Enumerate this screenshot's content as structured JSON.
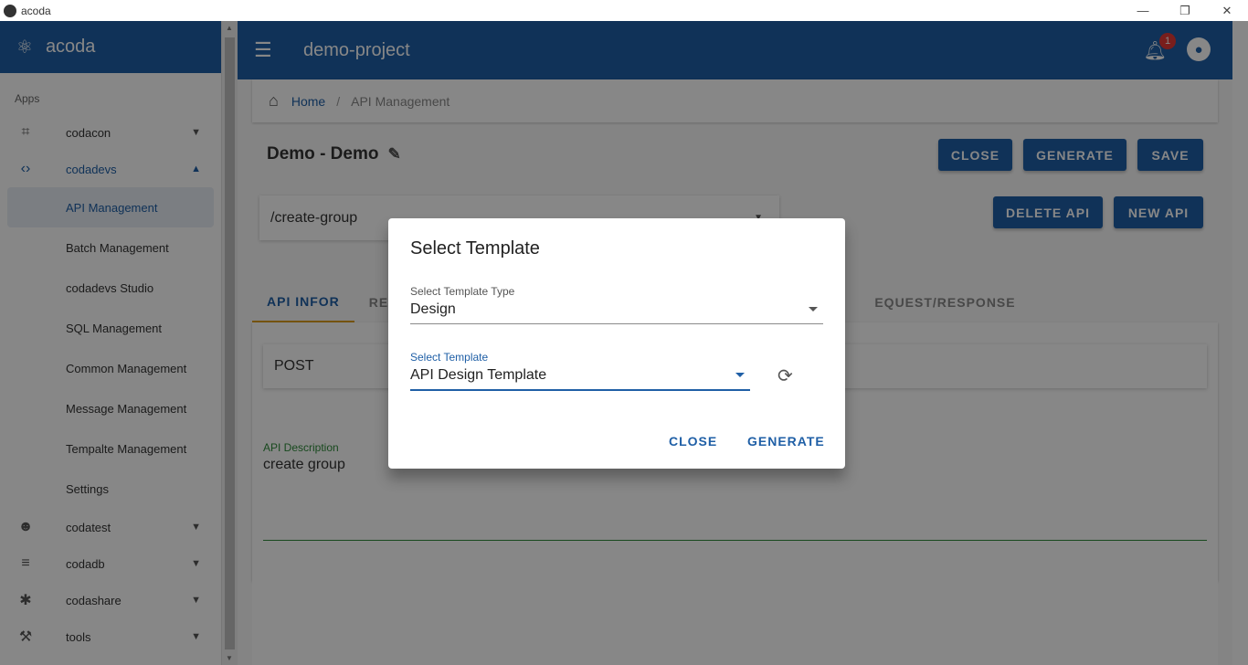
{
  "window": {
    "title": "acoda",
    "controls": [
      "—",
      "❐",
      "✕"
    ]
  },
  "sidebar": {
    "brand": "acoda",
    "section_label": "Apps",
    "groups": [
      {
        "label": "codacon",
        "icon": "crop-icon",
        "expanded": false
      },
      {
        "label": "codadevs",
        "icon": "code-icon",
        "expanded": true,
        "items": [
          "API Management",
          "Batch Management",
          "codadevs Studio",
          "SQL Management",
          "Common Management",
          "Message Management",
          "Tempalte Management",
          "Settings"
        ]
      },
      {
        "label": "codatest",
        "icon": "users-gear-icon",
        "expanded": false
      },
      {
        "label": "codadb",
        "icon": "database-icon",
        "expanded": false
      },
      {
        "label": "codashare",
        "icon": "share-network-icon",
        "expanded": false
      },
      {
        "label": "tools",
        "icon": "tools-icon",
        "expanded": false
      }
    ],
    "selected_item": "API Management"
  },
  "appbar": {
    "project": "demo-project",
    "notification_count": "1"
  },
  "breadcrumb": {
    "home": "Home",
    "separator": "/",
    "current": "API Management"
  },
  "page": {
    "title": "Demo - Demo",
    "buttons": {
      "close": "CLOSE",
      "generate": "GENERATE",
      "save": "SAVE",
      "delete_api": "DELETE API",
      "new_api": "NEW API"
    },
    "api_path": "/create-group",
    "tabs": [
      "API INFOR",
      "REC",
      "EQUEST/RESPONSE"
    ],
    "method": "POST",
    "description_label": "API Description",
    "description_value": "create group"
  },
  "dialog": {
    "title": "Select Template",
    "type_label": "Select Template Type",
    "type_value": "Design",
    "template_label": "Select Template",
    "template_value": "API Design Template",
    "close": "CLOSE",
    "generate": "GENERATE"
  },
  "colors": {
    "primary": "#1f5fa6",
    "accent": "#e0a020",
    "badge": "#e53935",
    "success": "#2e8b3a"
  }
}
